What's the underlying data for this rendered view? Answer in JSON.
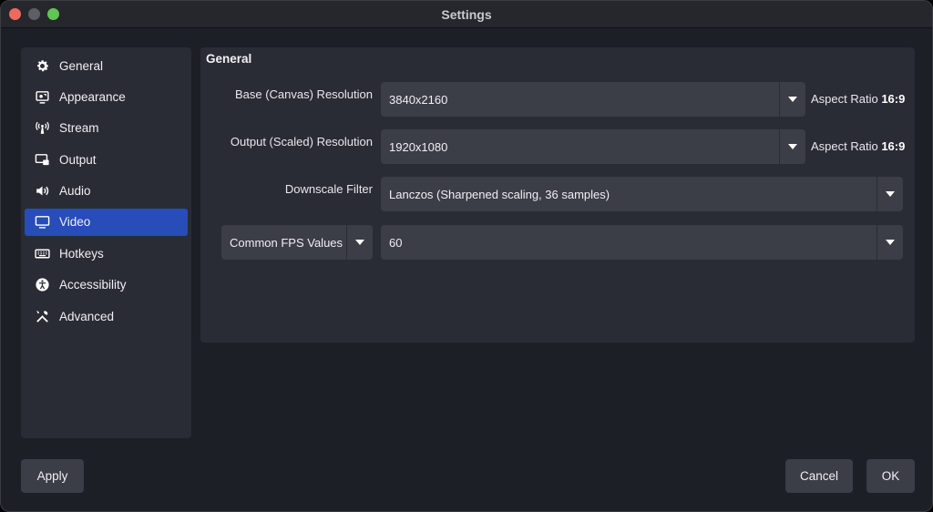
{
  "window": {
    "title": "Settings"
  },
  "sidebar": {
    "items": [
      {
        "label": "General",
        "icon": "gear-icon"
      },
      {
        "label": "Appearance",
        "icon": "appearance-icon"
      },
      {
        "label": "Stream",
        "icon": "antenna-icon"
      },
      {
        "label": "Output",
        "icon": "output-icon"
      },
      {
        "label": "Audio",
        "icon": "speaker-icon"
      },
      {
        "label": "Video",
        "icon": "monitor-icon",
        "active": true
      },
      {
        "label": "Hotkeys",
        "icon": "keyboard-icon"
      },
      {
        "label": "Accessibility",
        "icon": "accessibility-icon"
      },
      {
        "label": "Advanced",
        "icon": "tools-icon"
      }
    ]
  },
  "panel": {
    "title": "General",
    "base_resolution": {
      "label": "Base (Canvas) Resolution",
      "value": "3840x2160",
      "aspect_prefix": "Aspect Ratio",
      "aspect_value": "16:9"
    },
    "output_resolution": {
      "label": "Output (Scaled) Resolution",
      "value": "1920x1080",
      "aspect_prefix": "Aspect Ratio",
      "aspect_value": "16:9"
    },
    "downscale_filter": {
      "label": "Downscale Filter",
      "value": "Lanczos (Sharpened scaling, 36 samples)"
    },
    "fps": {
      "type": "Common FPS Values",
      "value": "60"
    }
  },
  "buttons": {
    "apply": "Apply",
    "cancel": "Cancel",
    "ok": "OK"
  },
  "colors": {
    "accent": "#284cb8",
    "background": "#1d1f26",
    "panel": "#2a2c35",
    "control": "#3b3d47"
  }
}
